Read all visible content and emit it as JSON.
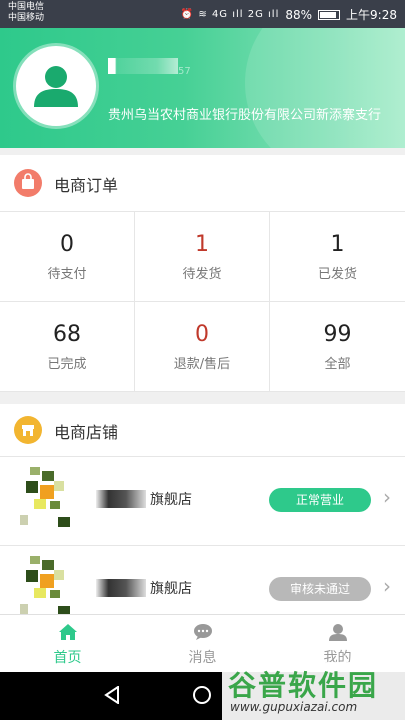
{
  "status_bar": {
    "carrier1": "中国电信",
    "carrier2": "中国移动",
    "indicators": "⏰ ≋ 4G ıll 2G ıll",
    "battery_percent": "88%",
    "battery_level": 0.88,
    "time": "上午9:28"
  },
  "profile": {
    "name_suffix": "57",
    "bank": "贵州乌当农村商业银行股份有限公司新添寨支行"
  },
  "orders": {
    "title": "电商订单",
    "icon": "shopping-bag-icon",
    "icon_color": "#f27c6a",
    "items": [
      {
        "count": "0",
        "label": "待支付",
        "highlight": false
      },
      {
        "count": "1",
        "label": "待发货",
        "highlight": true
      },
      {
        "count": "1",
        "label": "已发货",
        "highlight": false
      },
      {
        "count": "68",
        "label": "已完成",
        "highlight": false
      },
      {
        "count": "0",
        "label": "退款/售后",
        "highlight": true
      },
      {
        "count": "99",
        "label": "全部",
        "highlight": false
      }
    ]
  },
  "stores": {
    "title": "电商店铺",
    "icon": "store-icon",
    "icon_color": "#f2b530",
    "items": [
      {
        "name": "旗舰店",
        "status": "正常营业",
        "status_color": "#2ec98b"
      },
      {
        "name": "旗舰店",
        "status": "审核未通过",
        "status_color": "#b8b8b8"
      }
    ]
  },
  "tabs": [
    {
      "label": "首页",
      "icon": "home-icon",
      "active": true
    },
    {
      "label": "消息",
      "icon": "message-icon",
      "active": false
    },
    {
      "label": "我的",
      "icon": "profile-icon",
      "active": false
    }
  ],
  "colors": {
    "accent": "#2ec98b",
    "highlight": "#c0392b"
  },
  "watermark": {
    "text": "谷普软件园",
    "url": "www.gupuxiazai.com"
  }
}
